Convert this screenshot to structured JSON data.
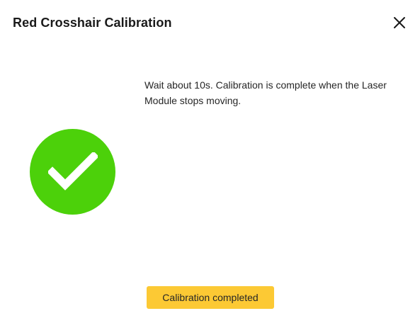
{
  "dialog": {
    "title": "Red Crosshair Calibration",
    "close_icon": "close-icon",
    "status_icon": "check-circle-icon",
    "instruction": "Wait about 10s. Calibration is complete when the Laser Module stops moving.",
    "action_button_label": "Calibration completed"
  },
  "colors": {
    "success": "#4cd10a",
    "button": "#fcc934",
    "text": "#262626"
  }
}
